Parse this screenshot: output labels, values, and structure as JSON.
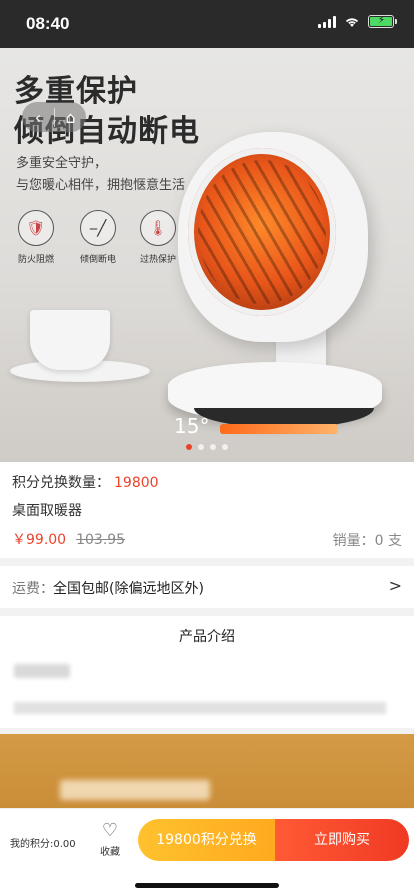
{
  "status_bar": {
    "time": "08:40"
  },
  "hero": {
    "title_line1": "多重保护",
    "title_line2": "倾倒自动断电",
    "subtitle_line1": "多重安全守护，",
    "subtitle_line2": "与您暖心相伴，拥抱惬意生活",
    "features": [
      {
        "label": "防火阻燃",
        "icon": "shield-fire-icon"
      },
      {
        "label": "倾倒断电",
        "icon": "tilt-switch-icon"
      },
      {
        "label": "过热保护",
        "icon": "thermometer-icon"
      }
    ],
    "temperature": "15°",
    "carousel_total": 4,
    "carousel_active": 1
  },
  "product": {
    "points_label": "积分兑换数量：",
    "points_value": "19800",
    "name": "桌面取暖器",
    "price": "￥99.00",
    "original_price": "103.95",
    "sales": "销量：0 支"
  },
  "shipping": {
    "label": "运费：",
    "value": "全国包邮(除偏远地区外)",
    "arrow": ">"
  },
  "intro": {
    "title": "产品介绍"
  },
  "bottom_bar": {
    "my_points": "我的积分:0.00",
    "favorite_label": "收藏",
    "exchange_button": "19800积分兑换",
    "buy_button": "立即购买"
  },
  "colors": {
    "accent": "#e9432c",
    "exchange": "#ffb52a",
    "buy": "#f24a2b"
  }
}
